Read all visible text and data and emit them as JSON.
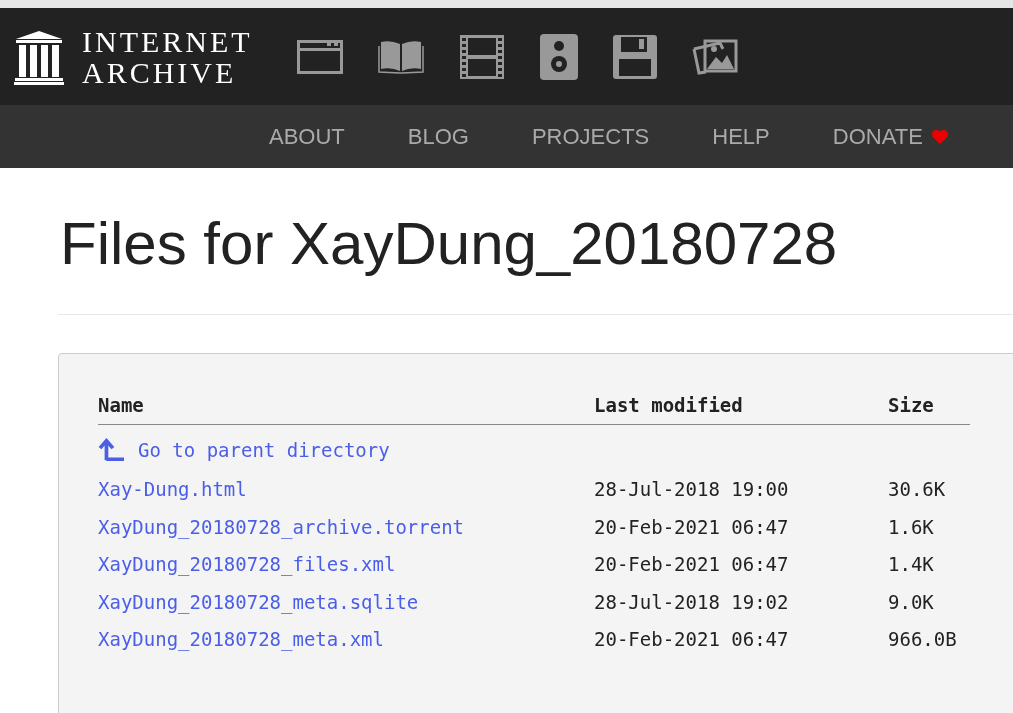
{
  "logo": {
    "line1": "INTERNET",
    "line2": "ARCHIVE"
  },
  "nav": [
    {
      "label": "ABOUT",
      "heart": false
    },
    {
      "label": "BLOG",
      "heart": false
    },
    {
      "label": "PROJECTS",
      "heart": false
    },
    {
      "label": "HELP",
      "heart": false
    },
    {
      "label": "DONATE",
      "heart": true
    }
  ],
  "title": "Files for XayDung_20180728",
  "table": {
    "columns": [
      "Name",
      "Last modified",
      "Size"
    ],
    "parent_link": "Go to parent directory",
    "rows": [
      {
        "name": "Xay-Dung.html",
        "modified": "28-Jul-2018 19:00",
        "size": "30.6K"
      },
      {
        "name": "XayDung_20180728_archive.torrent",
        "modified": "20-Feb-2021 06:47",
        "size": "1.6K"
      },
      {
        "name": "XayDung_20180728_files.xml",
        "modified": "20-Feb-2021 06:47",
        "size": "1.4K"
      },
      {
        "name": "XayDung_20180728_meta.sqlite",
        "modified": "28-Jul-2018 19:02",
        "size": "9.0K"
      },
      {
        "name": "XayDung_20180728_meta.xml",
        "modified": "20-Feb-2021 06:47",
        "size": "966.0B"
      }
    ]
  }
}
